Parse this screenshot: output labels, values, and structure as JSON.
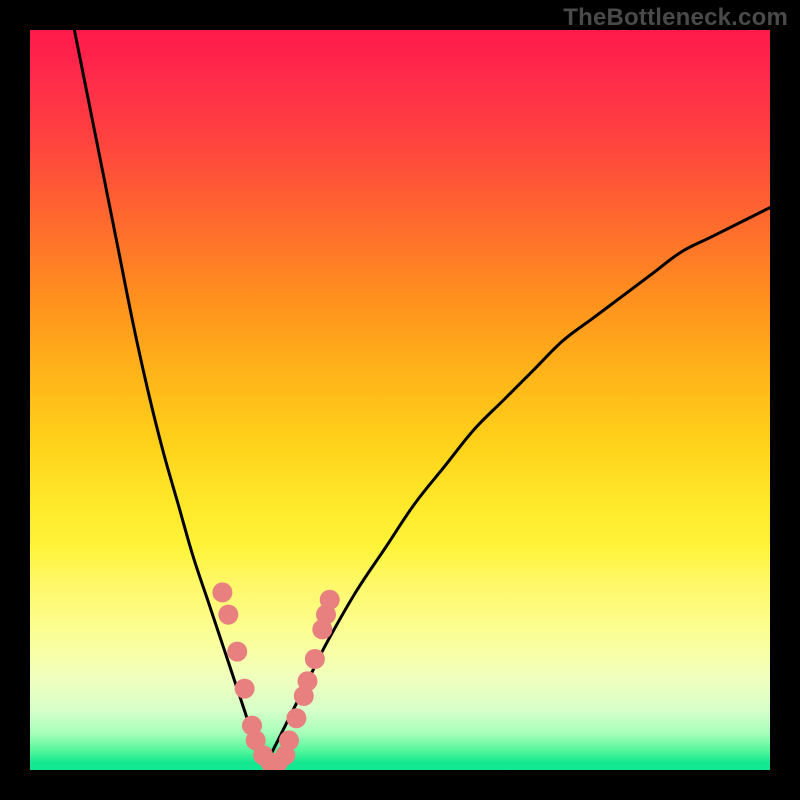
{
  "watermark": "TheBottleneck.com",
  "colors": {
    "frame": "#000000",
    "curve": "#000000",
    "marker_fill": "#e98080",
    "marker_stroke": "#cc6a6a"
  },
  "chart_data": {
    "type": "line",
    "title": "",
    "xlabel": "",
    "ylabel": "",
    "xlim": [
      0,
      100
    ],
    "ylim": [
      0,
      100
    ],
    "series": [
      {
        "name": "left-branch",
        "x": [
          6,
          8,
          10,
          12,
          14,
          16,
          18,
          20,
          22,
          24,
          25,
          26,
          27,
          28,
          29,
          30,
          31,
          32
        ],
        "y": [
          100,
          90,
          80,
          70,
          60,
          51,
          43,
          36,
          29,
          23,
          20,
          17,
          14,
          11,
          8,
          5,
          3,
          1
        ]
      },
      {
        "name": "right-branch",
        "x": [
          32,
          33,
          34,
          35,
          36,
          38,
          40,
          44,
          48,
          52,
          56,
          60,
          64,
          68,
          72,
          76,
          80,
          84,
          88,
          92,
          96,
          100
        ],
        "y": [
          1,
          3,
          5,
          7,
          9,
          13,
          17,
          24,
          30,
          36,
          41,
          46,
          50,
          54,
          58,
          61,
          64,
          67,
          70,
          72,
          74,
          76
        ]
      }
    ],
    "markers": {
      "name": "highlight-points",
      "x": [
        26,
        26.8,
        28,
        29,
        30,
        30.5,
        31.5,
        32.5,
        33.5,
        34.5,
        35,
        36,
        37,
        37.5,
        38.5,
        39.5,
        40,
        40.5
      ],
      "y": [
        24,
        21,
        16,
        11,
        6,
        4,
        2,
        1,
        1,
        2,
        4,
        7,
        10,
        12,
        15,
        19,
        21,
        23
      ]
    }
  }
}
